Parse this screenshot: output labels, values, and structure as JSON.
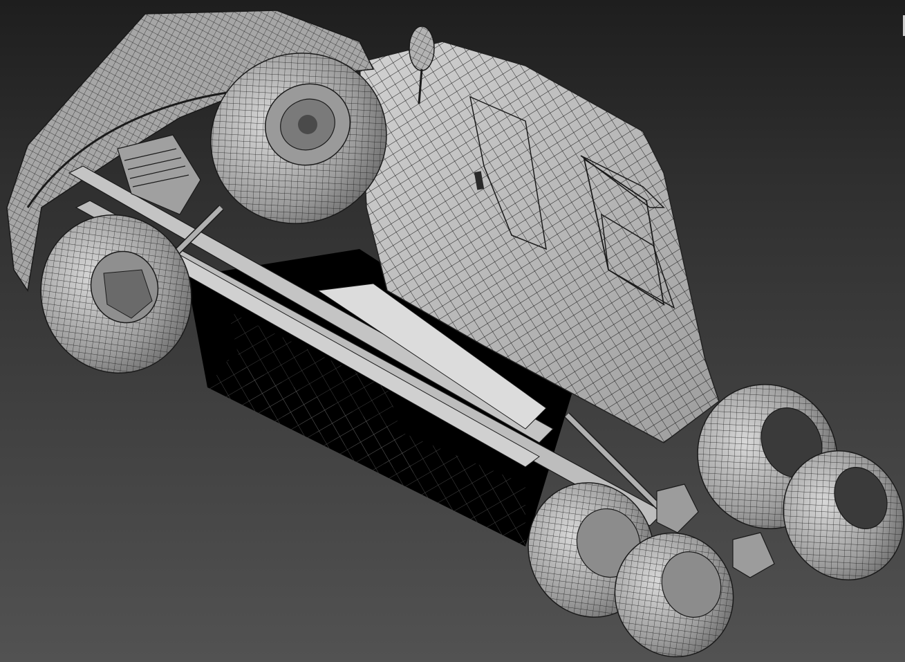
{
  "viewport": {
    "background_top": "#1e1e1e",
    "background_bottom": "#525252",
    "shaded_color": "#a9a9a9",
    "wire_color": "#141414",
    "shadow_color": "#000000",
    "subject": "truck-model-wireframe"
  }
}
